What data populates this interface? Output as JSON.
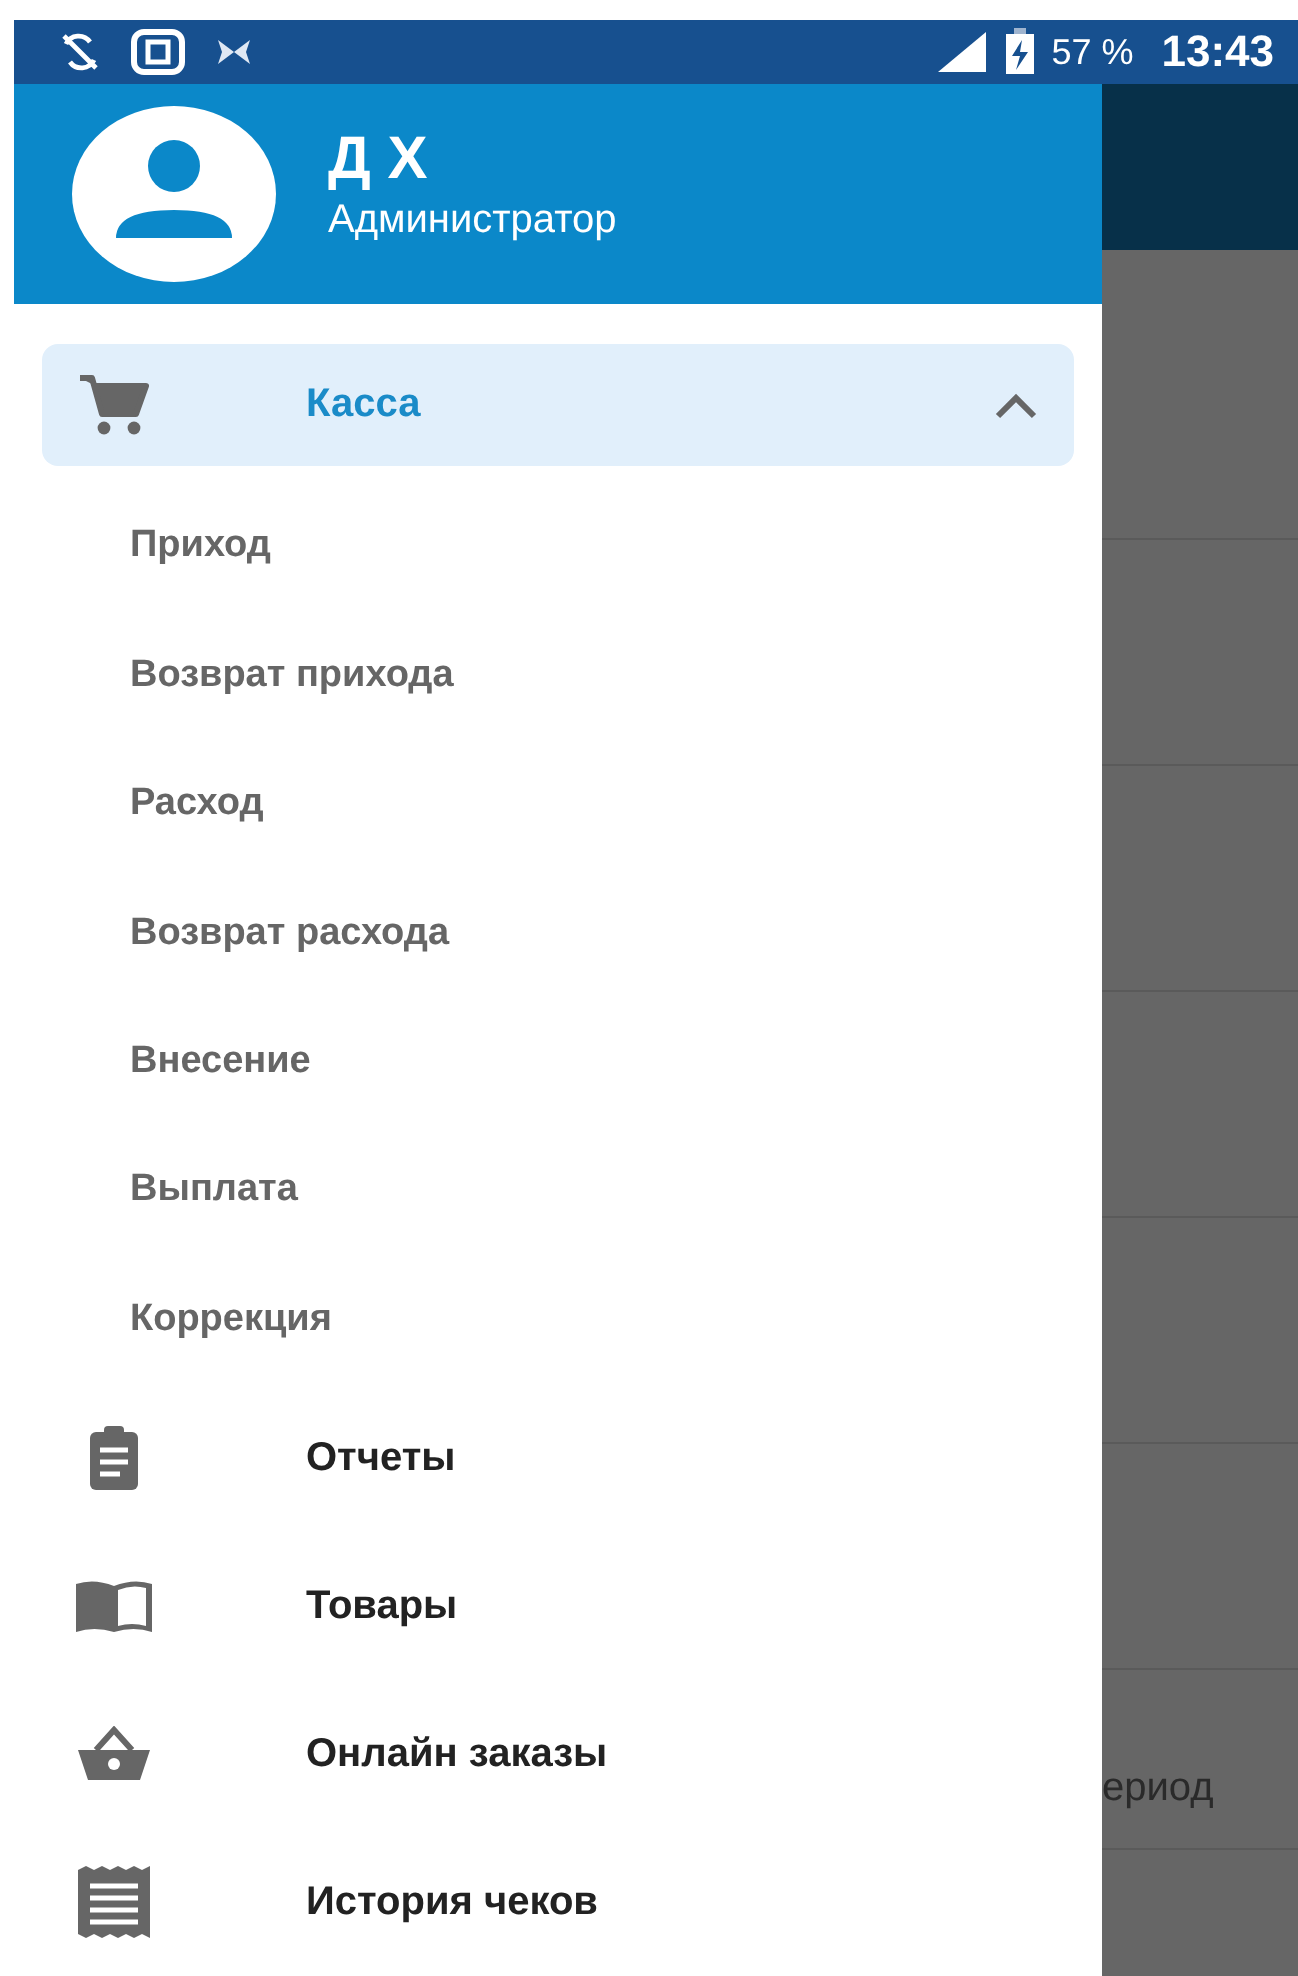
{
  "status_bar": {
    "battery": "57 %",
    "time": "13:43"
  },
  "user": {
    "name": "Д Х",
    "role": "Администратор"
  },
  "menu": [
    {
      "label": "Касса",
      "selected": true,
      "expanded": true,
      "children": [
        {
          "label": "Приход"
        },
        {
          "label": "Возврат прихода"
        },
        {
          "label": "Расход"
        },
        {
          "label": "Возврат расхода"
        },
        {
          "label": "Внесение"
        },
        {
          "label": "Выплата"
        },
        {
          "label": "Коррекция"
        }
      ]
    },
    {
      "label": "Отчеты",
      "selected": false
    },
    {
      "label": "Товары",
      "selected": false
    },
    {
      "label": "Онлайн заказы",
      "selected": false
    },
    {
      "label": "История чеков",
      "selected": false
    }
  ],
  "background": {
    "row_text": "ериод"
  }
}
